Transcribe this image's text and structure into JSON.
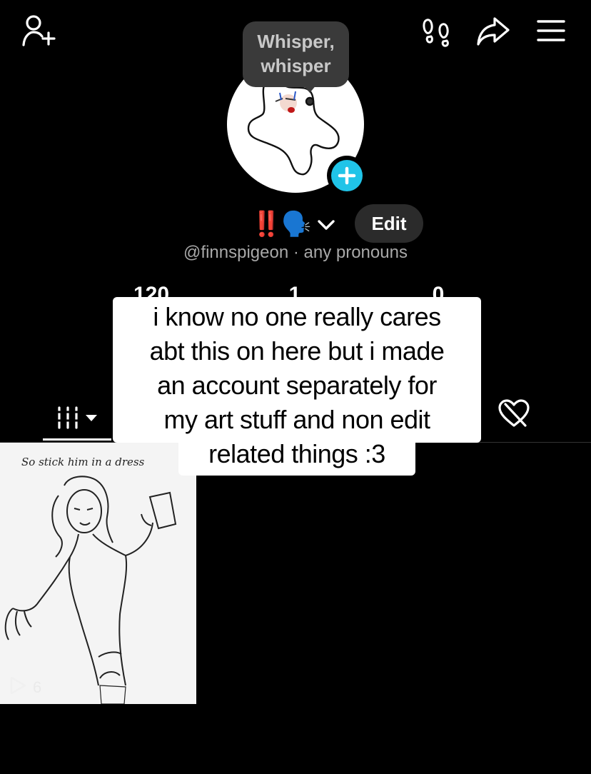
{
  "header": {
    "add_friend_icon": "person-plus-icon",
    "footprints_icon": "footprints-icon",
    "share_icon": "share-arrow-icon",
    "menu_icon": "hamburger-menu-icon"
  },
  "profile": {
    "tooltip": "Whisper, whisper",
    "tooltip_line1": "Whisper,",
    "tooltip_line2": "whisper",
    "name_emoji": "‼️🗣️",
    "edit_label": "Edit",
    "handle": "@finnspigeon",
    "separator": " · ",
    "pronouns": "any pronouns",
    "accent_color": "#20c4e8"
  },
  "stats": {
    "following": "120",
    "followers": "1",
    "likes": "0"
  },
  "caption": {
    "lines": [
      "i know no one really cares",
      "abt this on here but i made",
      "an account separately for",
      "my art stuff and non edit",
      "related things :3"
    ]
  },
  "tabs": {
    "videos_icon": "grid-videos-icon",
    "liked_icon": "liked-heart-hidden-icon"
  },
  "videos": [
    {
      "caption": "So stick him in a dress",
      "views": "6"
    }
  ]
}
